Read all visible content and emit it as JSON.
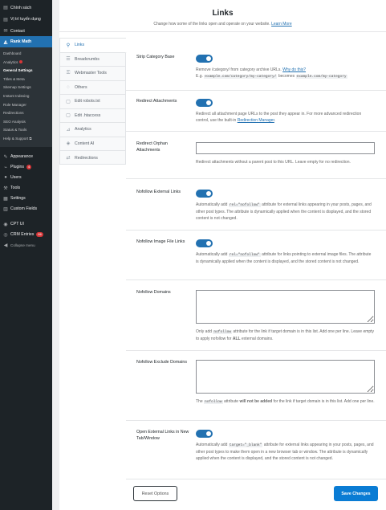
{
  "wp_menu": {
    "top_items": [
      {
        "label": "Chính sách",
        "icon": "page-icon"
      },
      {
        "label": "Vị trí tuyển dụng",
        "icon": "page-icon"
      },
      {
        "label": "Contact",
        "icon": "mail-icon"
      },
      {
        "label": "Rank Math",
        "icon": "rankmath-icon"
      }
    ],
    "rank_math_sub": [
      {
        "label": "Dashboard"
      },
      {
        "label": "Analytics"
      },
      {
        "label": "General Settings"
      },
      {
        "label": "Titles & Meta"
      },
      {
        "label": "Sitemap Settings"
      },
      {
        "label": "Instant Indexing"
      },
      {
        "label": "Role Manager"
      },
      {
        "label": "Redirections"
      },
      {
        "label": "SEO Analysis"
      },
      {
        "label": "Status & Tools"
      },
      {
        "label": "Help & Support ⧉"
      }
    ],
    "bottom_items": [
      {
        "label": "Appearance",
        "icon": "brush-icon"
      },
      {
        "label": "Plugins",
        "icon": "plug-icon",
        "badge": "4"
      },
      {
        "label": "Users",
        "icon": "user-icon"
      },
      {
        "label": "Tools",
        "icon": "wrench-icon"
      },
      {
        "label": "Settings",
        "icon": "settings-icon"
      },
      {
        "label": "Custom Fields",
        "icon": "fields-icon"
      },
      {
        "label": "CPT UI",
        "icon": "cpt-icon"
      },
      {
        "label": "CRM Entries",
        "icon": "crm-icon",
        "badge": "86"
      },
      {
        "label": "Collapse menu",
        "icon": "collapse-icon"
      }
    ]
  },
  "header": {
    "title": "Links",
    "description": "Change how some of the links open and operate on your website.",
    "learn_more": "Learn More"
  },
  "tabs": [
    {
      "label": "Links",
      "icon": "link-icon"
    },
    {
      "label": "Breadcrumbs",
      "icon": "breadcrumb-icon"
    },
    {
      "label": "Webmaster Tools",
      "icon": "webmaster-icon"
    },
    {
      "label": "Others",
      "icon": "others-icon"
    },
    {
      "label": "Edit robots.txt",
      "icon": "robots-icon"
    },
    {
      "label": "Edit .htaccess",
      "icon": "htaccess-icon"
    },
    {
      "label": "Analytics",
      "icon": "analytics-icon"
    },
    {
      "label": "Content AI",
      "icon": "content-ai-icon"
    },
    {
      "label": "Redirections",
      "icon": "redirections-icon"
    }
  ],
  "settings": {
    "strip_category_base": {
      "label": "Strip Category Base",
      "enabled": true,
      "desc_a": "Remove /category/ from category archive URLs.",
      "why_link": "Why do this?",
      "desc_eg": "E.g.",
      "code_from": "example.com/category/my-category/",
      "desc_becomes": "becomes",
      "code_to": "example.com/my-category"
    },
    "redirect_attachments": {
      "label": "Redirect Attachments",
      "enabled": true,
      "desc_a": "Redirect all attachment page URLs to the post they appear in. For more advanced redirection control, use the built-in",
      "link": "Redirection Manager",
      "desc_b": "."
    },
    "redirect_orphan": {
      "label": "Redirect Orphan Attachments",
      "value": "",
      "desc": "Redirect attachments without a parent post to this URL. Leave empty for no redirection."
    },
    "nofollow_external": {
      "label": "Nofollow External Links",
      "enabled": true,
      "desc_a": "Automatically add",
      "code": "rel=\"nofollow\"",
      "desc_b": "attribute for external links appearing in your posts, pages, and other post types. The attribute is dynamically applied when the content is displayed, and the stored content is not changed."
    },
    "nofollow_image": {
      "label": "Nofollow Image File Links",
      "enabled": true,
      "desc_a": "Automatically add",
      "code": "rel=\"nofollow\"",
      "desc_b": "attribute for links pointing to external image files. The attribute is dynamically applied when the content is displayed, and the stored content is not changed."
    },
    "nofollow_domains": {
      "label": "Nofollow Domains",
      "value": "",
      "desc_a": "Only add",
      "code": "nofollow",
      "desc_b": "attribute for the link if target domain is in this list. Add one per line. Leave empty to apply nofollow for",
      "desc_strong": "ALL",
      "desc_c": "external domains."
    },
    "nofollow_exclude": {
      "label": "Nofollow Exclude Domains",
      "value": "",
      "desc_a": "The",
      "code": "nofollow",
      "desc_b": "attribute",
      "desc_strong": "will not be added",
      "desc_c": "for the link if target domain is in this list. Add one per line."
    },
    "open_external_new_tab": {
      "label": "Open External Links in New Tab/Window",
      "enabled": true,
      "desc_a": "Automatically add",
      "code": "target=\"_blank\"",
      "desc_b": "attribute for external links appearing in your posts, pages, and other post types to make them open in a new browser tab or window. The attribute is dynamically applied when the content is displayed, and the stored content is not changed."
    }
  },
  "footer": {
    "reset_label": "Reset Options",
    "save_label": "Save Changes"
  },
  "colors": {
    "wp_sidebar": "#1d2327",
    "wp_active": "#2271b1",
    "toggle_on": "#2271b1",
    "save_button": "#0a7cd4"
  }
}
